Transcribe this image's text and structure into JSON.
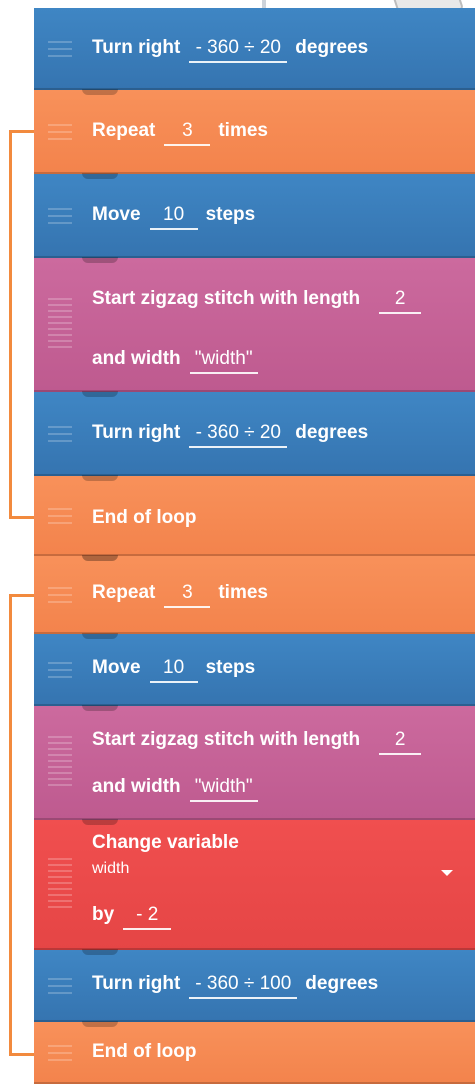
{
  "blocks": [
    {
      "id": "b1",
      "type": "turn",
      "color": "blue",
      "label": "Turn right",
      "value": "- 360 ÷ 20",
      "suffix": "degrees"
    },
    {
      "id": "b2",
      "type": "repeat",
      "color": "orange",
      "label": "Repeat",
      "value": "3",
      "suffix": "times"
    },
    {
      "id": "b3",
      "type": "move",
      "color": "blue",
      "label": "Move",
      "value": "10",
      "suffix": "steps"
    },
    {
      "id": "b4",
      "type": "zigzag",
      "color": "pink",
      "label": "Start zigzag stitch with length",
      "value": "2",
      "label2": "and width",
      "value2": "\"width\""
    },
    {
      "id": "b5",
      "type": "turn",
      "color": "blue",
      "label": "Turn right",
      "value": "- 360 ÷ 20",
      "suffix": "degrees"
    },
    {
      "id": "b6",
      "type": "end",
      "color": "orange",
      "label": "End of loop"
    },
    {
      "id": "b7",
      "type": "repeat",
      "color": "orange",
      "label": "Repeat",
      "value": "3",
      "suffix": "times"
    },
    {
      "id": "b8",
      "type": "move",
      "color": "blue",
      "label": "Move",
      "value": "10",
      "suffix": "steps"
    },
    {
      "id": "b9",
      "type": "zigzag",
      "color": "pink",
      "label": "Start zigzag stitch with length",
      "value": "2",
      "label2": "and width",
      "value2": "\"width\""
    },
    {
      "id": "b10",
      "type": "change",
      "color": "red",
      "label": "Change variable",
      "variable": "width",
      "label2": "by",
      "value2": "- 2"
    },
    {
      "id": "b11",
      "type": "turn",
      "color": "blue",
      "label": "Turn right",
      "value": "- 360 ÷ 100",
      "suffix": "degrees"
    },
    {
      "id": "b12",
      "type": "end",
      "color": "orange",
      "label": "End of loop"
    }
  ],
  "colors": {
    "blue": "#3a7dbd",
    "orange": "#f68a53",
    "pink": "#c8649a",
    "red": "#ee4b4b",
    "loop_bracket": "#f28a3e"
  }
}
